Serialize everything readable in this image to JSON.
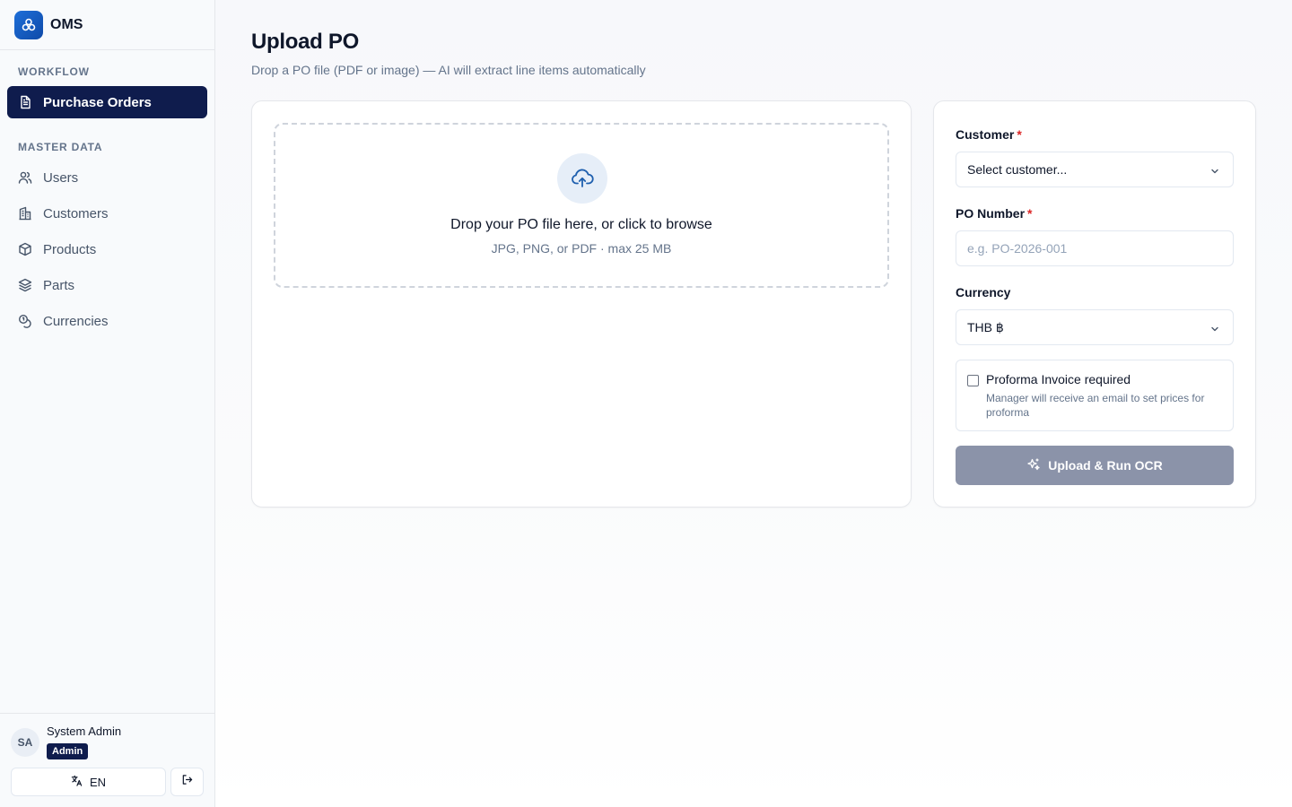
{
  "app": {
    "name": "OMS"
  },
  "sidebar": {
    "sections": [
      {
        "label": "WORKFLOW"
      },
      {
        "label": "MASTER DATA"
      }
    ],
    "items": [
      {
        "label": "Purchase Orders",
        "icon": "file-text-icon",
        "active": true
      },
      {
        "label": "Users",
        "icon": "users-icon"
      },
      {
        "label": "Customers",
        "icon": "building-icon"
      },
      {
        "label": "Products",
        "icon": "box-icon"
      },
      {
        "label": "Parts",
        "icon": "layers-icon"
      },
      {
        "label": "Currencies",
        "icon": "coins-icon"
      }
    ]
  },
  "user": {
    "initials": "SA",
    "name": "System Admin",
    "role": "Admin",
    "language": "EN"
  },
  "page": {
    "title": "Upload PO",
    "subtitle": "Drop a PO file (PDF or image) — AI will extract line items automatically"
  },
  "dropzone": {
    "title": "Drop your PO file here, or click to browse",
    "hint": "JPG, PNG, or PDF · max 25 MB",
    "icon": "cloud-upload-icon"
  },
  "form": {
    "customer": {
      "label": "Customer",
      "required_mark": "*",
      "value": "Select customer..."
    },
    "po_number": {
      "label": "PO Number",
      "required_mark": "*",
      "placeholder": "e.g. PO-2026-001"
    },
    "currency": {
      "label": "Currency",
      "value": "THB ฿"
    },
    "proforma": {
      "label": "Proforma Invoice required",
      "description": "Manager will receive an email to set prices for proforma",
      "checked": false
    },
    "submit_label": "Upload & Run OCR"
  },
  "colors": {
    "nav_active": "#0f1c4d",
    "brand": "#1e6fd9",
    "button_disabled": "#8b93a9",
    "required": "#dc2626"
  }
}
